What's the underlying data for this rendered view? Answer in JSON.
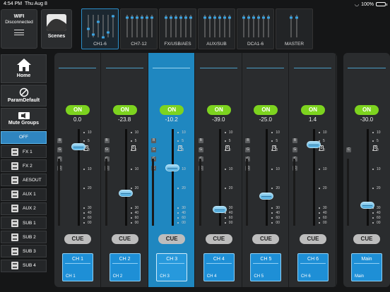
{
  "status": {
    "time": "4:54 PM",
    "date": "Thu Aug 8",
    "battery": "100%"
  },
  "wifi": {
    "title": "WIFI",
    "state": "Disconnected"
  },
  "scenes": {
    "label": "Scenes"
  },
  "banks": [
    {
      "label": "CH1-6",
      "active": true
    },
    {
      "label": "CH7-12",
      "active": false
    },
    {
      "label": "FX/USB/AES",
      "active": false
    },
    {
      "label": "AUX/SUB",
      "active": false
    },
    {
      "label": "DCA1-6",
      "active": false
    },
    {
      "label": "MASTER",
      "active": false
    }
  ],
  "nav": {
    "home": "Home",
    "param_default": "ParamDefault",
    "mute_groups": "Mute Groups",
    "off": "OFF",
    "sends": [
      "FX 1",
      "FX 2",
      "AESOUT",
      "AUX 1",
      "AUX 2",
      "SUB 1",
      "SUB 2",
      "SUB 3",
      "SUB 4"
    ]
  },
  "channels": [
    {
      "on": "ON",
      "gain": "0.0",
      "fader": 0.0,
      "cue": "CUE",
      "name": "CH 1",
      "sub": "CH 1",
      "selected": false
    },
    {
      "on": "ON",
      "gain": "-23.8",
      "fader": -23.8,
      "cue": "CUE",
      "name": "CH 2",
      "sub": "CH 2",
      "selected": false
    },
    {
      "on": "ON",
      "gain": "-10.2",
      "fader": -10.2,
      "cue": "CUE",
      "name": "CH 3",
      "sub": "CH 3",
      "selected": true
    },
    {
      "on": "ON",
      "gain": "-39.0",
      "fader": -39.0,
      "cue": "CUE",
      "name": "CH 4",
      "sub": "CH 4",
      "selected": false
    },
    {
      "on": "ON",
      "gain": "-25.0",
      "fader": -25.0,
      "cue": "CUE",
      "name": "CH 5",
      "sub": "CH 5",
      "selected": false
    },
    {
      "on": "ON",
      "gain": "1.4",
      "fader": 1.4,
      "cue": "CUE",
      "name": "CH 6",
      "sub": "CH 6",
      "selected": false
    }
  ],
  "main": {
    "on": "ON",
    "gain": "-30.0",
    "fader": -30.0,
    "cue": "CUE",
    "name": "Main",
    "sub": "Main"
  },
  "scale": [
    "10",
    "5",
    "0",
    "10",
    "20",
    "30",
    "40",
    "60",
    "00"
  ],
  "toggles": [
    "B",
    "G",
    "C",
    "C"
  ],
  "colors": {
    "accent": "#1f87c0",
    "on": "#7dd31f",
    "cue": "#bdbdbd"
  }
}
